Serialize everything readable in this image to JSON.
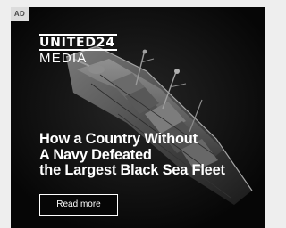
{
  "ad": {
    "badge": "AD",
    "brand": {
      "name_top": "UNITED24",
      "name_bottom": "MEDIA"
    },
    "headline": [
      "How a Country Without",
      "A Navy Defeated",
      "the Largest Black Sea Fleet"
    ],
    "cta_label": "Read more"
  },
  "colors": {
    "background": "#060606",
    "text": "#ffffff",
    "page": "#eeeeee",
    "badge_bg": "#dcdcdc"
  }
}
